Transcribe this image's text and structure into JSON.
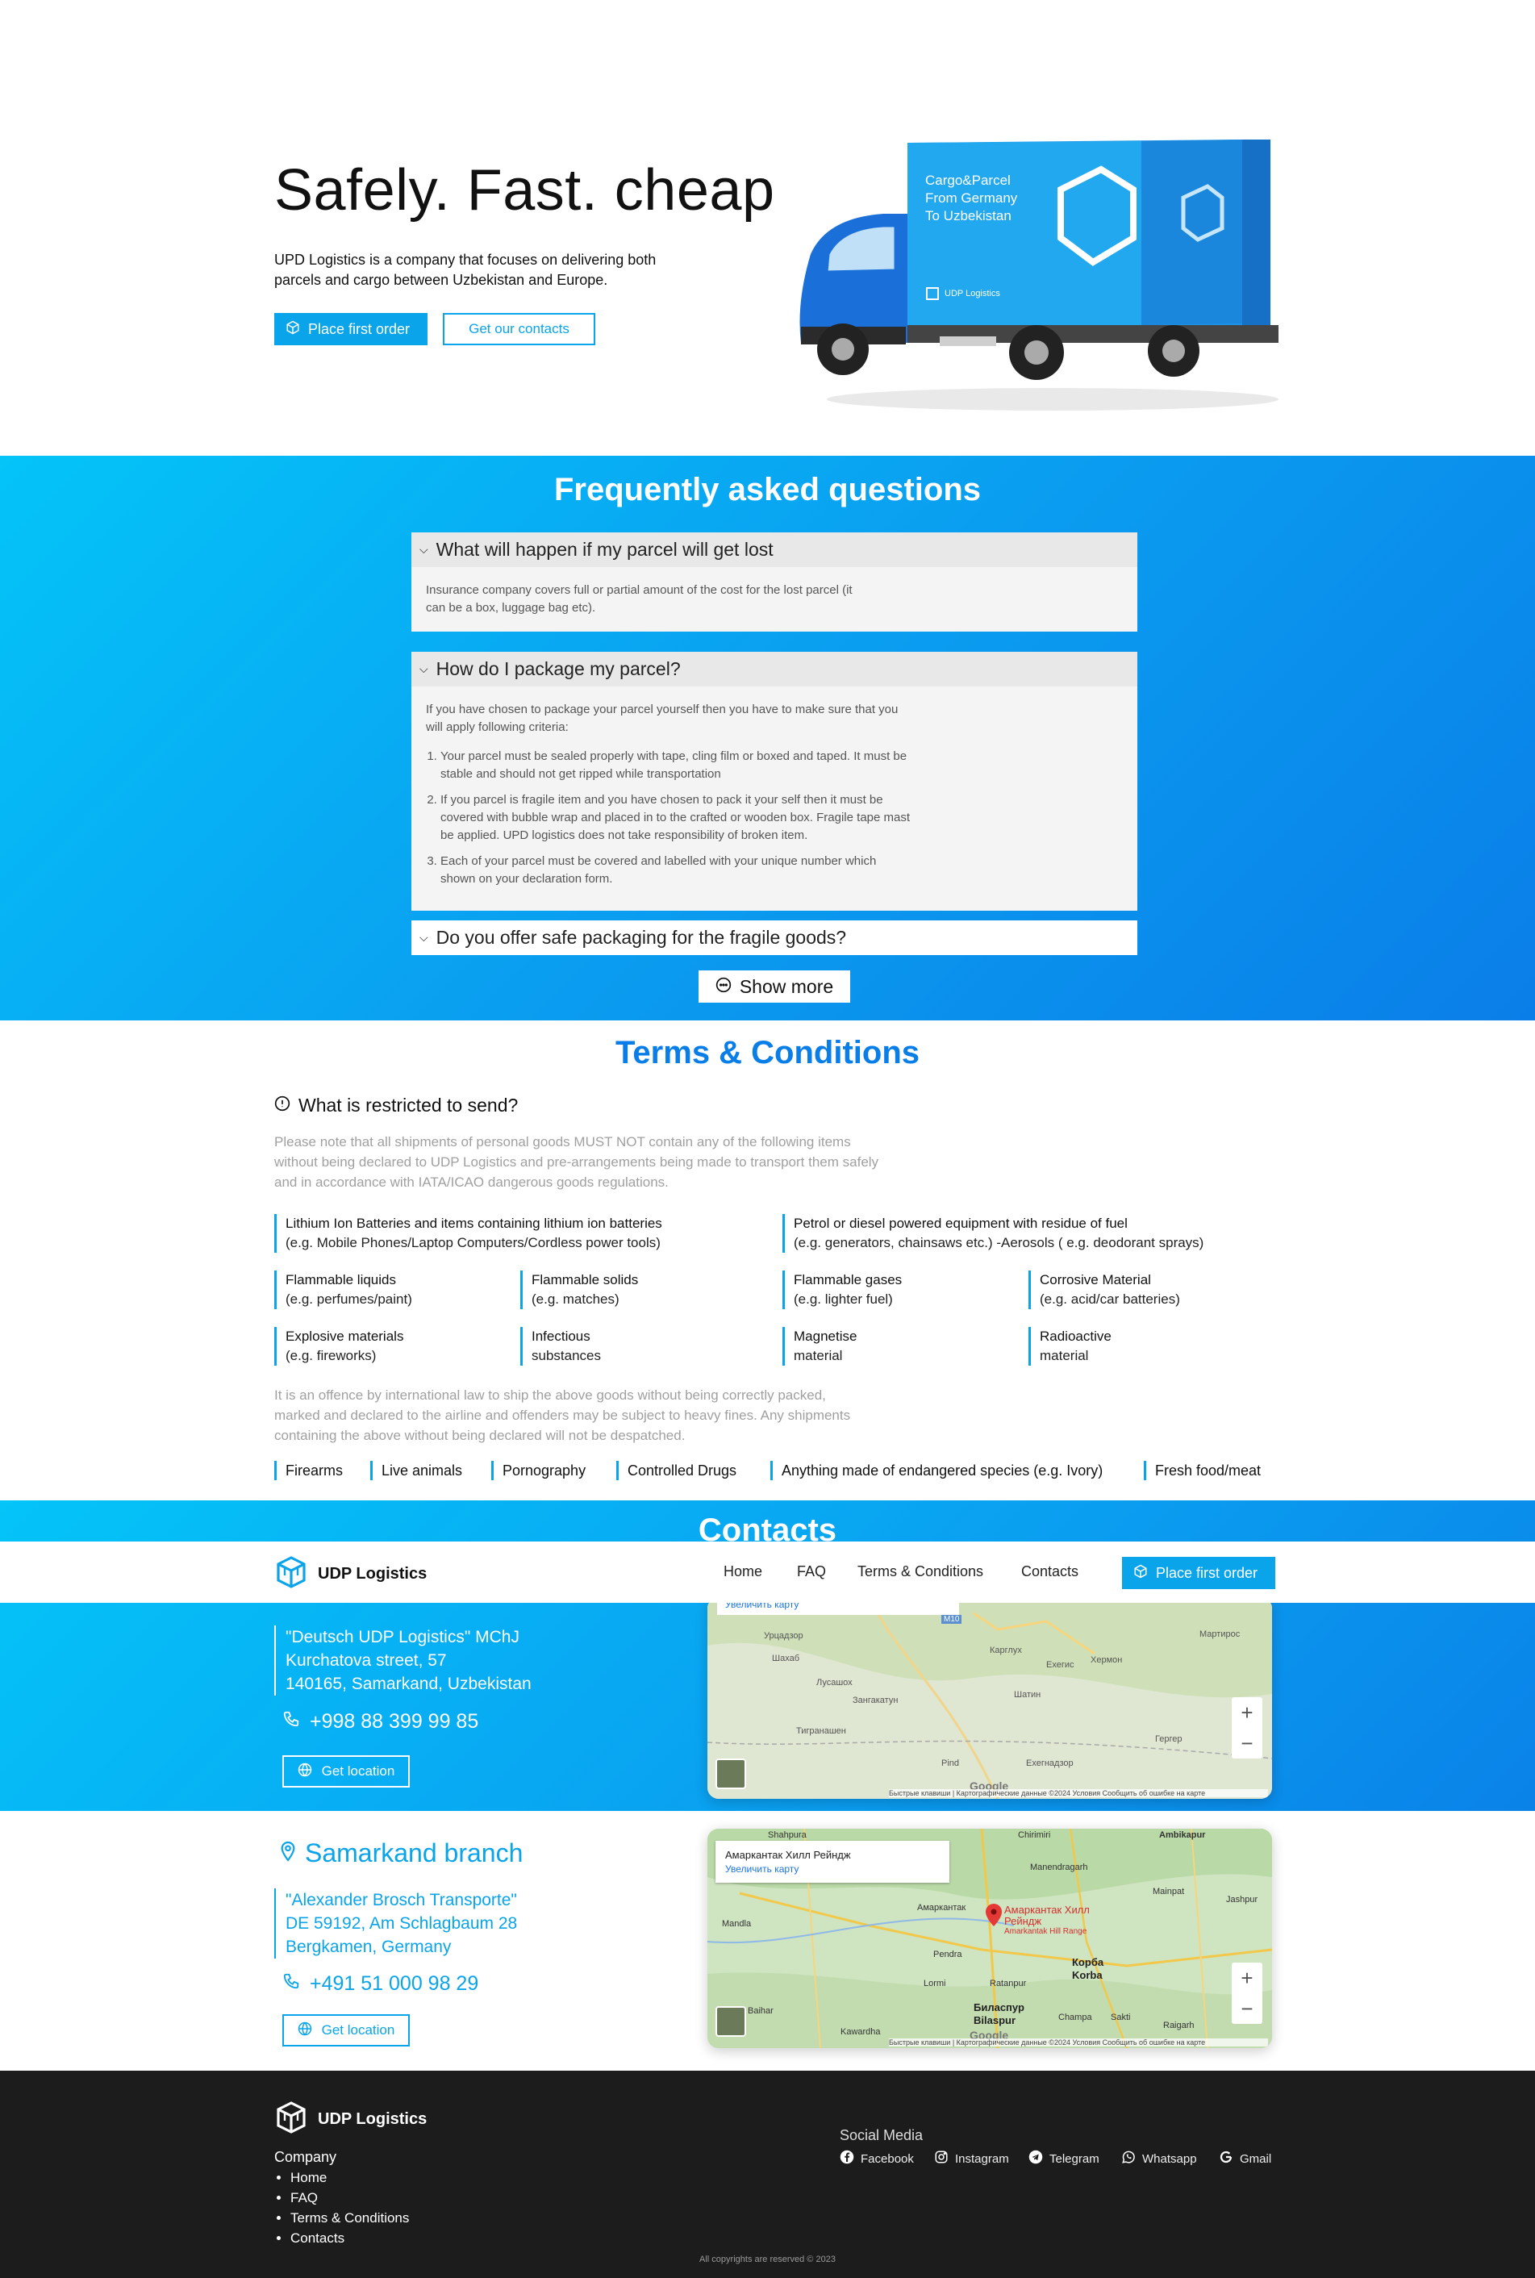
{
  "hero": {
    "title": "Safely. Fast. cheap",
    "description": "UPD Logistics is a company that focuses on delivering both parcels and cargo between Uzbekistan and Europe.",
    "primary_button": "Place first order",
    "secondary_button": "Get our contacts",
    "truck_text_line1": "Cargo&Parcel",
    "truck_text_line2": "From Germany",
    "truck_text_line3": "To Uzbekistan",
    "truck_brand": "UDP Logistics"
  },
  "faq": {
    "title": "Frequently asked questions",
    "items": [
      {
        "question": "What will happen if my parcel will get lost",
        "answer": "Insurance company covers full or partial amount of the cost for the lost parcel (it can be a box, luggage bag etc)."
      },
      {
        "question": "How do I package my parcel?",
        "answer": "If you have chosen to package your parcel yourself then you have to make sure that you will apply following criteria:",
        "steps": [
          "Your parcel must be sealed properly with tape, cling film or boxed and taped. It must be stable and should not get ripped while transportation",
          "If you parcel is fragile item and you have chosen to pack it your self then it must be covered with bubble wrap and placed in to the crafted or wooden box. Fragile tape mast be applied. UPD logistics does not take responsibility of broken item.",
          "Each of your parcel must be covered and labelled with your unique number which shown on your declaration form."
        ]
      },
      {
        "question": "Do you offer safe packaging for the fragile goods?"
      }
    ],
    "show_more": "Show more"
  },
  "terms": {
    "title": "Terms & Conditions",
    "restricted_heading": "What is restricted to send?",
    "notice": "Please note that all shipments of personal goods MUST NOT contain any of the following items without being declared to UDP Logistics and pre-arrangements being made to transport them safely and in accordance with IATA/ICAO dangerous goods regulations.",
    "restricted_items": [
      {
        "name": "Lithium Ion Batteries and items containing lithium ion batteries",
        "detail": "(e.g. Mobile Phones/Laptop Computers/Cordless power tools)"
      },
      {
        "name": "Petrol or diesel powered equipment with residue of fuel",
        "detail": "(e.g. generators, chainsaws etc.) -Aerosols ( e.g. deodorant sprays)"
      },
      {
        "name": "Flammable liquids",
        "detail": "(e.g. perfumes/paint)"
      },
      {
        "name": "Flammable solids",
        "detail": "(e.g. matches)"
      },
      {
        "name": "Flammable gases",
        "detail": "(e.g. lighter fuel)"
      },
      {
        "name": "Corrosive Material",
        "detail": "(e.g. acid/car batteries)"
      },
      {
        "name": "Explosive materials",
        "detail": "(e.g. fireworks)"
      },
      {
        "name": "Infectious",
        "detail": "substances"
      },
      {
        "name": "Magnetise",
        "detail": "material"
      },
      {
        "name": "Radioactive",
        "detail": "material"
      }
    ],
    "offence_notice": "It is an offence by international law to ship the above goods without being correctly packed, marked and declared to the airline and offenders may be subject to heavy fines. Any shipments containing the above without being declared will not be despatched.",
    "prohibited_items": [
      "Firearms",
      "Live animals",
      "Pornography",
      "Controlled Drugs",
      "Anything made of endangered species (e.g. Ivory)",
      "Fresh food/meat"
    ]
  },
  "contacts": {
    "title": "Contacts",
    "branch1": {
      "address_lines": [
        "\"Deutsch UDP Logistics\" MChJ",
        "Kurchatova street, 57",
        "140165, Samarkand, Uzbekistan"
      ],
      "phone": "+998 88 399 99 85",
      "location_button": "Get location",
      "map_enlarge": "Увеличить карту",
      "map_footer": "Быстрые клавиши | Картографические данные ©2024   Условия   Сообщить об ошибке на карте"
    },
    "branch2": {
      "title": "Samarkand branch",
      "address_lines": [
        "\"Alexander Brosch Transporte\"",
        "DE 59192, Am Schlagbaum 28",
        "Bergkamen, Germany"
      ],
      "phone": "+491 51 000 98 29",
      "location_button": "Get location",
      "map_place": "Амаркантак Хилл Рейндж",
      "map_enlarge": "Увеличить карту",
      "map_pin_label": "Амаркантак Хилл Рейндж",
      "map_pin_label_en": "Amarkantak Hill Range",
      "map_footer": "Быстрые клавиши | Картографические данные ©2024   Условия   Сообщить об ошибке на карте"
    },
    "map1_labels": [
      "Урцадзор",
      "Шахаб",
      "Лусашох",
      "Зангакатун",
      "Тигранашен",
      "Карглух",
      "Ехегис",
      "Хермон",
      "Шатин",
      "Рind",
      "Ехегнадзор",
      "Гергер",
      "Мартирос",
      "M10"
    ],
    "map2_labels": [
      "Shahpura",
      "Chirimiri",
      "Ambikapur",
      "Mainpat",
      "Jashpur",
      "Амаркантак",
      "Mandla",
      "Manendragarh",
      "Pendra",
      "Lormi",
      "Ratanpur",
      "Корба",
      "Korba",
      "Bilaspur",
      "Биласпур",
      "Champa",
      "Sakti",
      "Raigarh",
      "Baihar",
      "Kawardha"
    ]
  },
  "navbar": {
    "brand": "UDP Logistics",
    "links": [
      "Home",
      "FAQ",
      "Terms & Conditions",
      "Contacts"
    ],
    "cta": "Place first order"
  },
  "footer": {
    "brand": "UDP Logistics",
    "company_heading": "Company",
    "company_links": [
      "Home",
      "FAQ",
      "Terms & Conditions",
      "Contacts"
    ],
    "social_heading": "Social Media",
    "socials": [
      "Facebook",
      "Instagram",
      "Telegram",
      "Whatsapp",
      "Gmail"
    ],
    "copyright": "All copyrights are reserved © 2023"
  },
  "colors": {
    "accent": "#0aa4ea",
    "terms_title": "#0a7ee8",
    "footer_bg": "#1c1c1d"
  }
}
